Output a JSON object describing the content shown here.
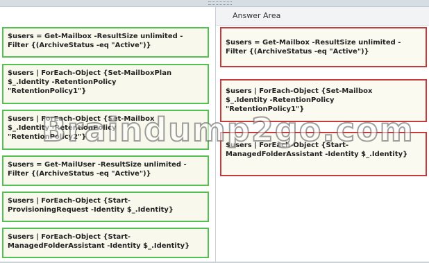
{
  "answer_area": {
    "title": "Answer Area"
  },
  "source_items": [
    {
      "text": "$users = Get-Mailbox -ResultSize unlimited -\nFilter {(ArchiveStatus -eq \"Active\")}"
    },
    {
      "text": "$users | ForEach-Object {Set-MailboxPlan\n$_.Identity -RetentionPolicy\n\"RetentionPolicy1\"}"
    },
    {
      "text": "$users | ForEach-Object {Set-Mailbox\n$_.Identity -RetentionPolicy\n\"RetentionPolicy2\"}"
    },
    {
      "text": "$users = Get-MailUser -ResultSize unlimited -\nFilter {(ArchiveStatus -eq \"Active\")}"
    },
    {
      "text": "$users | ForEach-Object {Start-\nProvisioningRequest -Identity $_.Identity}"
    },
    {
      "text": "$users | ForEach-Object {Start-\nManagedFolderAssistant -Identity $_.Identity}"
    }
  ],
  "answer_items": [
    {
      "text": "$users = Get-Mailbox -ResultSize unlimited -\nFilter {(ArchiveStatus -eq \"Active\")}"
    },
    {
      "text": "$users | ForEach-Object {Set-Mailbox\n$_.Identity -RetentionPolicy\n\"RetentionPolicy1\"}"
    },
    {
      "text": "$users | ForEach-Object {Start-\nManagedFolderAssistant -Identity $_.Identity}"
    }
  ],
  "watermark": "Braindump2go.com",
  "colors": {
    "source_border": "#52c152",
    "answer_border": "#c43b3b"
  }
}
